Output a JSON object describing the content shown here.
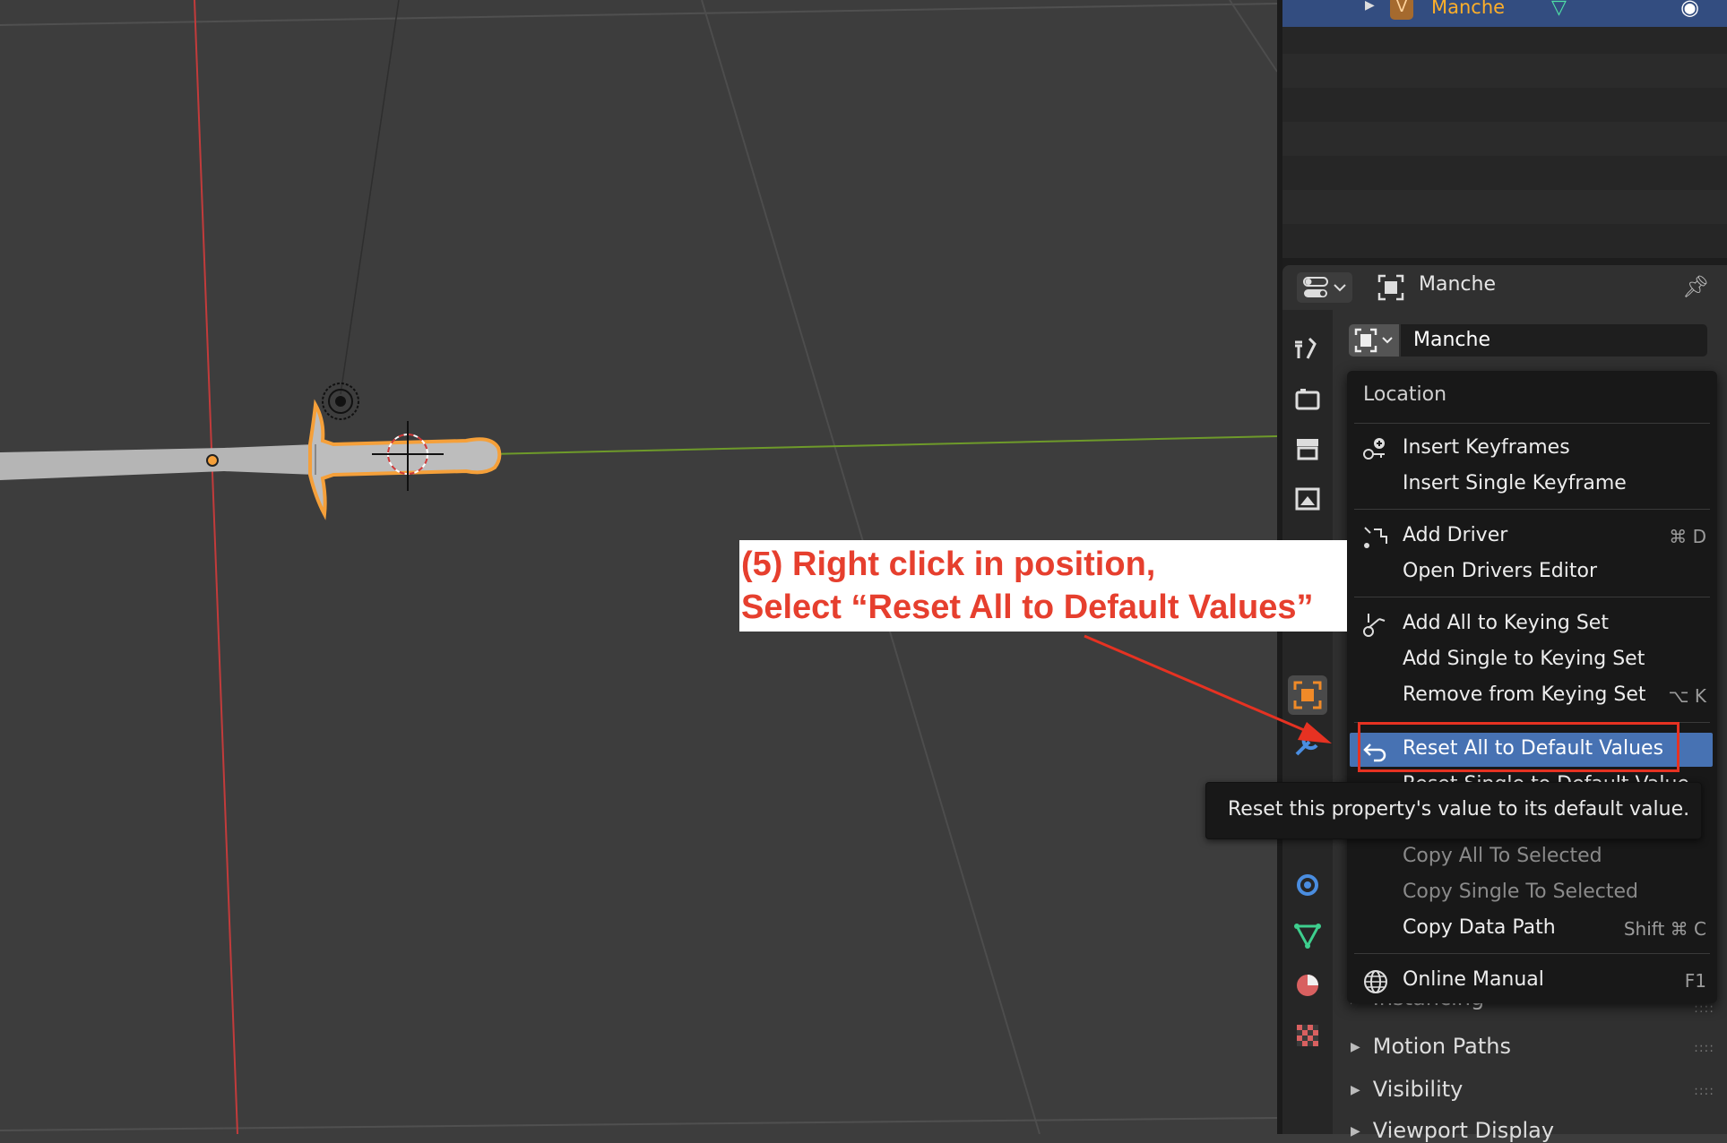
{
  "outliner": {
    "selected_object": "Manche"
  },
  "properties": {
    "header_title": "Manche",
    "object_name": "Manche",
    "panels": [
      "Instancing",
      "Motion Paths",
      "Visibility",
      "Viewport Display"
    ]
  },
  "context_menu": {
    "title": "Location",
    "items": [
      {
        "label": "Insert Keyframes",
        "shortcut": ""
      },
      {
        "label": "Insert Single Keyframe",
        "shortcut": ""
      },
      {
        "label": "Add Driver",
        "shortcut": "⌘ D"
      },
      {
        "label": "Open Drivers Editor",
        "shortcut": ""
      },
      {
        "label": "Add All to Keying Set",
        "shortcut": ""
      },
      {
        "label": "Add Single to Keying Set",
        "shortcut": ""
      },
      {
        "label": "Remove from Keying Set",
        "shortcut": "⌥ K"
      },
      {
        "label": "Reset All to Default Values",
        "shortcut": ""
      },
      {
        "label": "Reset Single to Default Value",
        "shortcut": ""
      },
      {
        "label": "Copy All To Selected",
        "shortcut": ""
      },
      {
        "label": "Copy Single To Selected",
        "shortcut": ""
      },
      {
        "label": "Copy Data Path",
        "shortcut": "Shift ⌘ C"
      },
      {
        "label": "Online Manual",
        "shortcut": "F1"
      }
    ]
  },
  "tooltip": {
    "text": "Reset this property's value to its default value."
  },
  "annotation": {
    "line1": "(5) Right click in position,",
    "line2": "Select “Reset All to Default Values”"
  },
  "colors": {
    "highlight": "#4772b3",
    "annotation_red": "#e63f2e",
    "outliner_selection": "#334d80",
    "object_orange": "#ffaf29"
  }
}
